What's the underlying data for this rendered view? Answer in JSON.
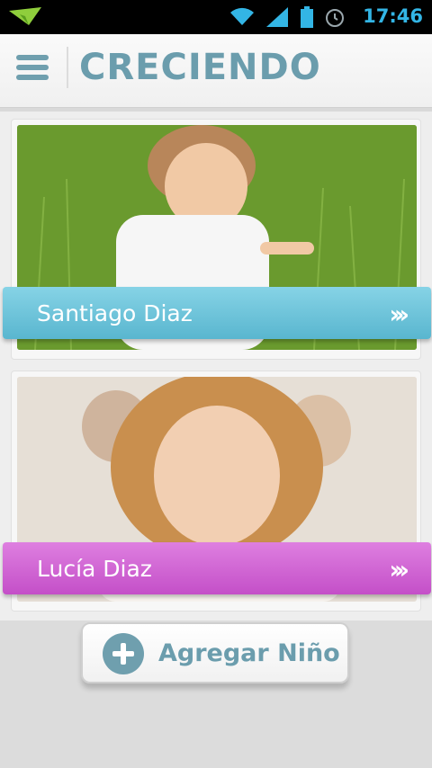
{
  "status_bar": {
    "time": "17:46"
  },
  "app_bar": {
    "title": "CRECIENDO"
  },
  "children": [
    {
      "name": "Santiago Diaz",
      "ribbon_color": "#5fb9d1"
    },
    {
      "name": "Lucía Diaz",
      "ribbon_color": "#c955cd"
    }
  ],
  "actions": {
    "add_label": "Agregar Niño"
  },
  "colors": {
    "accent": "#6b9dad",
    "status_blue": "#33b5e5"
  }
}
